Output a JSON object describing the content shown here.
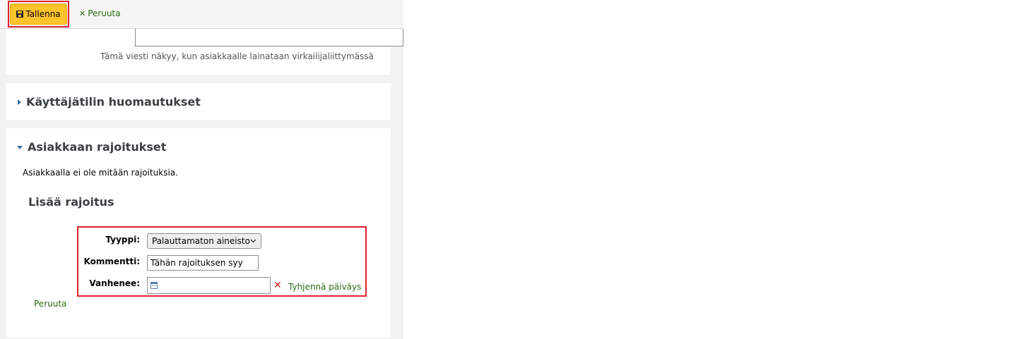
{
  "toolbar": {
    "save_label": "Tallenna",
    "cancel_label": "Peruuta",
    "cancel_glyph": "✕"
  },
  "message": {
    "hint": "Tämä viesti näkyy, kun asiakkaalle lainataan virkailijaliittymässä"
  },
  "sections": {
    "account_notes": {
      "title": "Käyttäjätilin huomautukset",
      "expanded": false
    },
    "restrictions": {
      "title": "Asiakkaan rajoitukset",
      "expanded": true,
      "empty_text": "Asiakkaalla ei ole mitään rajoituksia."
    }
  },
  "add_restriction": {
    "heading": "Lisää rajoitus",
    "type_label": "Tyyppi:",
    "type_selected": "Palauttamaton aineisto",
    "comment_label": "Kommentti:",
    "comment_value": "Tähän rajoituksen syy",
    "expires_label": "Vanhenee:",
    "expires_value": "",
    "clear_date_glyph": "✕",
    "clear_date_label": "Tyhjennä päiväys",
    "cancel_label": "Peruuta"
  },
  "colors": {
    "save_button": "#ffc32b",
    "highlight": "#e0202e",
    "link": "#2a6b12",
    "clear_icon": "#cc1f1f"
  }
}
